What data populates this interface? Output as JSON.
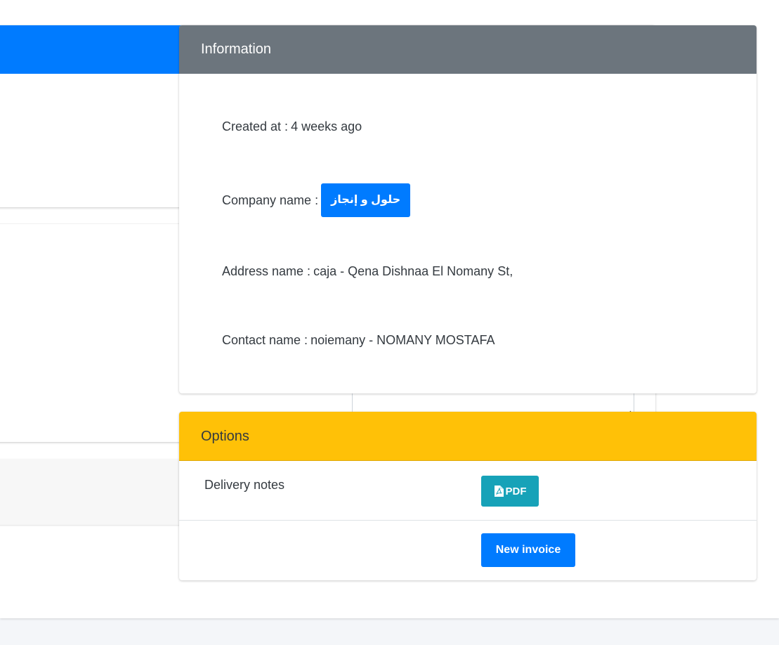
{
  "information": {
    "title": "Information",
    "created_label": "Created at :",
    "created_value": "4 weeks ago",
    "company_label": "Company name :",
    "company_value": "حلول و إنجاز",
    "address_label": "Address name :",
    "address_value": "caja - Qena Dishnaa El Nomany St,",
    "contact_label": "Contact name :",
    "contact_value": "noiemany - NOMANY MOSTAFA"
  },
  "options": {
    "title": "Options",
    "delivery_notes_label": "Delivery notes",
    "pdf_button_label": "PDF",
    "pdf_icon": "file-pdf-icon",
    "new_invoice_label": "New invoice"
  },
  "colors": {
    "primary": "#007bff",
    "secondary": "#6c757d",
    "warning": "#ffc107",
    "info": "#17a2b8"
  }
}
